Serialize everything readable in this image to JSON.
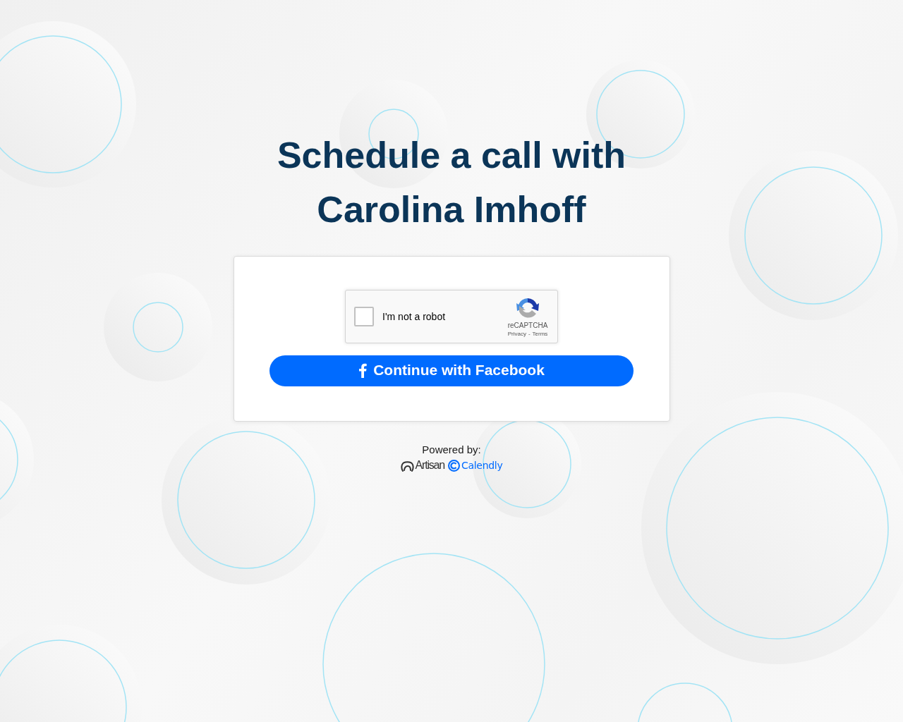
{
  "heading": "Schedule a call with Carolina Imhoff",
  "captcha": {
    "label": "I'm not a robot",
    "checked": false,
    "brand": "reCAPTCHA",
    "links": [
      "Privacy",
      "Terms"
    ],
    "separator": "-"
  },
  "facebook_button": {
    "label": "Continue with Facebook"
  },
  "powered_by": {
    "label": "Powered by:",
    "logos": [
      {
        "kind": "artisan",
        "name": "Artisan"
      },
      {
        "kind": "calendly",
        "name": "Calendly"
      }
    ]
  }
}
